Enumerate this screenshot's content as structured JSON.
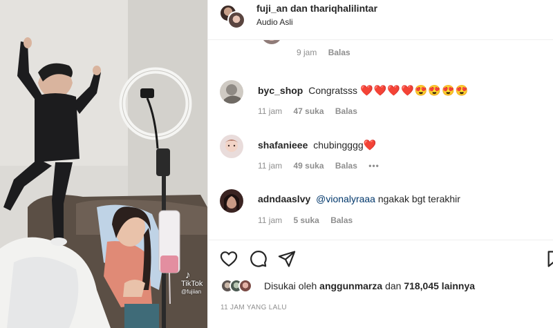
{
  "post": {
    "authors": "fuji_an dan thariqhalilintar",
    "audio": "Audio Asli",
    "watermark_brand": "TikTok",
    "watermark_user": "@fujiian"
  },
  "partial_comment": {
    "time": "9 jam",
    "reply": "Balas"
  },
  "comments": [
    {
      "user": "byc_shop",
      "text": "Congratsss",
      "emoji": "❤️❤️❤️❤️😍😍😍😍",
      "time": "11 jam",
      "likes": "47 suka",
      "reply": "Balas",
      "more": ""
    },
    {
      "user": "shafanieee",
      "text": "chubingggg",
      "emoji": "❤️",
      "time": "11 jam",
      "likes": "49 suka",
      "reply": "Balas",
      "more": "•••"
    },
    {
      "user": "adndaaslvy",
      "mention": "@vionalyraaa",
      "text": "ngakak bgt terakhir",
      "emoji": "",
      "time": "11 jam",
      "likes": "5 suka",
      "reply": "Balas",
      "more": ""
    }
  ],
  "actions": {
    "like_icon": "heart-icon",
    "comment_icon": "comment-bubble-icon",
    "share_icon": "paper-plane-icon",
    "save_icon": "bookmark-icon"
  },
  "likes": {
    "prefix": "Disukai oleh",
    "user": "anggunmarza",
    "connector": "dan",
    "count": "718,045 lainnya"
  },
  "timestamp": "11 JAM YANG LALU",
  "colors": {
    "heart": "#ed4956",
    "mention": "#00376b",
    "meta": "#8e8e8e"
  }
}
